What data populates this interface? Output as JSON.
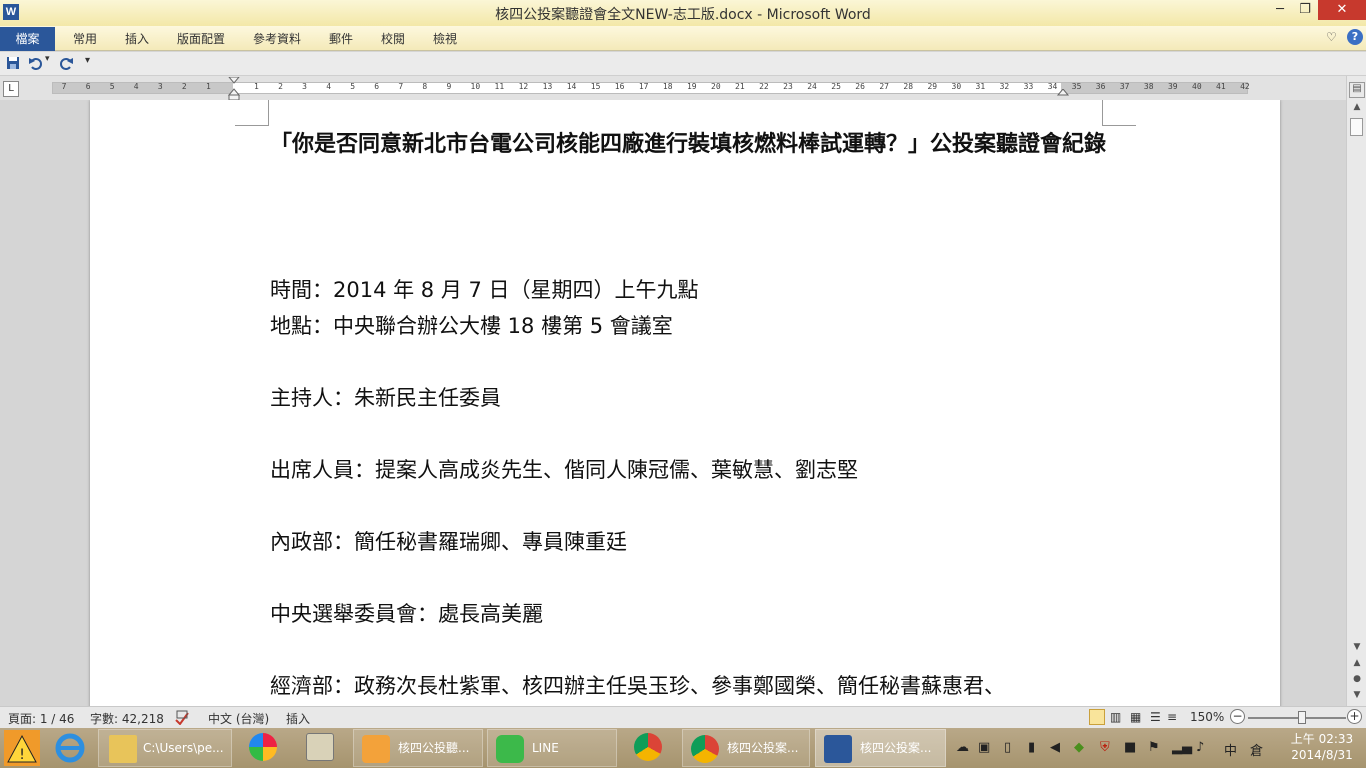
{
  "window": {
    "title": "核四公投案聽證會全文NEW-志工版.docx - Microsoft Word",
    "app_logo_letter": "W",
    "minimize": "─",
    "maximize": "❐",
    "close": "✕"
  },
  "ribbon": {
    "file_tab": "檔案",
    "tabs": [
      "常用",
      "插入",
      "版面配置",
      "參考資料",
      "郵件",
      "校閱",
      "檢視"
    ],
    "collapse_icon": "♡",
    "help": "?"
  },
  "qat": {
    "save_icon": "save-icon",
    "undo_icon": "undo-icon",
    "redo_icon": "redo-icon",
    "customize_icon": "dropdown-icon"
  },
  "ruler": {
    "tab_selector": "L",
    "left_numbers": [
      "7",
      "6",
      "5",
      "4",
      "3",
      "2",
      "1"
    ],
    "right_numbers": [
      "1",
      "2",
      "3",
      "4",
      "5",
      "6",
      "7",
      "8",
      "9",
      "10",
      "11",
      "12",
      "13",
      "14",
      "15",
      "16",
      "17",
      "18",
      "19",
      "20",
      "21",
      "22",
      "23",
      "24",
      "25",
      "26",
      "27",
      "28",
      "29",
      "30",
      "31",
      "32",
      "33",
      "34",
      "35",
      "36",
      "37",
      "38",
      "39",
      "40",
      "41",
      "42"
    ]
  },
  "document": {
    "title": "「你是否同意新北市台電公司核能四廠進行裝填核燃料棒試運轉？」公投案聽證會紀錄",
    "lines": [
      "時間：2014 年 8 月 7 日（星期四）上午九點",
      "地點：中央聯合辦公大樓 18 樓第 5 會議室",
      "主持人：朱新民主任委員",
      "出席人員：提案人高成炎先生、偕同人陳冠儒、葉敏慧、劉志堅",
      "內政部：簡任秘書羅瑞卿、專員陳重廷",
      "中央選舉委員會：處長高美麗",
      "經濟部：政務次長杜紫軍、核四辦主任吳玉珍、參事鄭國榮、簡任秘書蘇惠君、"
    ]
  },
  "status_bar": {
    "page": "頁面: 1 / 46",
    "words": "字數: 42,218",
    "language": "中文 (台灣)",
    "mode": "插入",
    "zoom": "150%"
  },
  "taskbar": {
    "buttons": [
      {
        "label": "C:\\Users\\pe..."
      },
      {
        "label": "核四公投聽..."
      },
      {
        "label": "LINE"
      },
      {
        "label": "核四公投案..."
      },
      {
        "label": "核四公投案..."
      }
    ],
    "tray_ime": "中",
    "clock_time": "上午 02:33",
    "clock_date": "2014/8/31"
  },
  "colors": {
    "word_blue": "#2b579a",
    "title_bar": "#f3e8a8",
    "close_red": "#c7392d"
  }
}
